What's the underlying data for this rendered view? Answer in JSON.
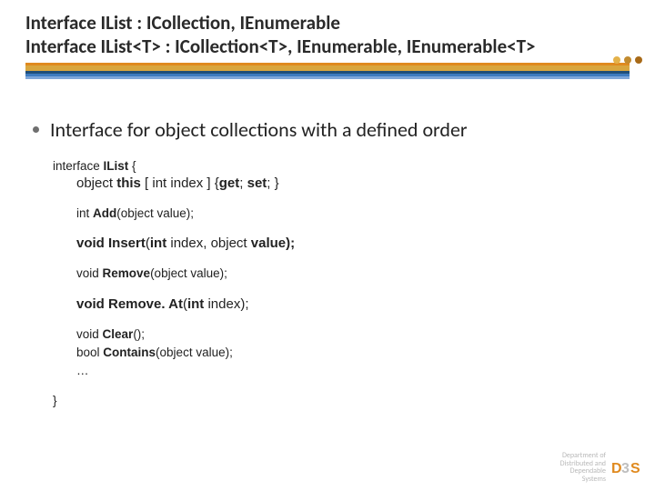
{
  "title": {
    "line1": "Interface IList : ICollection, IEnumerable",
    "line2": "Interface IList<T> : ICollection<T>, IEnumerable, IEnumerable<T>"
  },
  "dot_colors": [
    "#e4b24a",
    "#c28b2f",
    "#a86a18"
  ],
  "bullet": "Interface for object collections with a defined order",
  "code": {
    "open": "interface IList {",
    "indexer": "object this [ int index ] {get; set; }",
    "add": "int Add(object value);",
    "insert": "void Insert(int index, object value);",
    "remove": "void Remove(object value);",
    "removeAt": "void Remove. At(int index);",
    "clear": "void Clear();",
    "contains": "bool Contains(object value);",
    "ellipsis": "…",
    "close": "}"
  },
  "footer": {
    "line1": "Department of",
    "line2": "Distributed and",
    "line3": "Dependable",
    "line4": "Systems",
    "logo_text": "D3S"
  }
}
